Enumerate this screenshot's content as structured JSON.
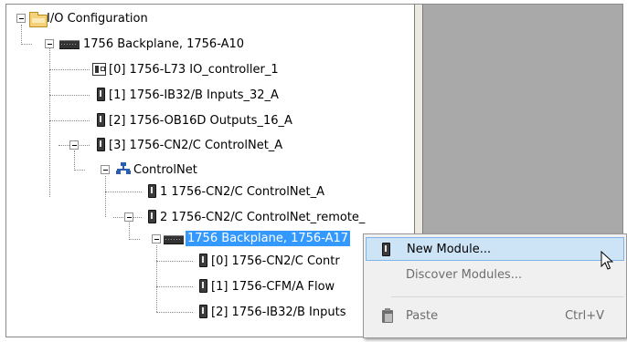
{
  "tree": {
    "root": "I/O Configuration",
    "backplane": "1756 Backplane, 1756-A10",
    "slot0": "[0] 1756-L73 IO_controller_1",
    "slot1": "[1] 1756-IB32/B Inputs_32_A",
    "slot2": "[2] 1756-OB16D Outputs_16_A",
    "slot3": "[3] 1756-CN2/C ControlNet_A",
    "network": "ControlNet",
    "node1": "1 1756-CN2/C ControlNet_A",
    "node2": "2 1756-CN2/C ControlNet_remote_",
    "remote_backplane": "1756 Backplane, 1756-A17",
    "remote_slot0": "[0] 1756-CN2/C Contr",
    "remote_slot1": "[1] 1756-CFM/A Flow",
    "remote_slot2": "[2] 1756-IB32/B Inputs"
  },
  "context_menu": {
    "new_module": "New Module...",
    "discover_modules": "Discover Modules...",
    "paste": "Paste",
    "paste_shortcut": "Ctrl+V"
  }
}
